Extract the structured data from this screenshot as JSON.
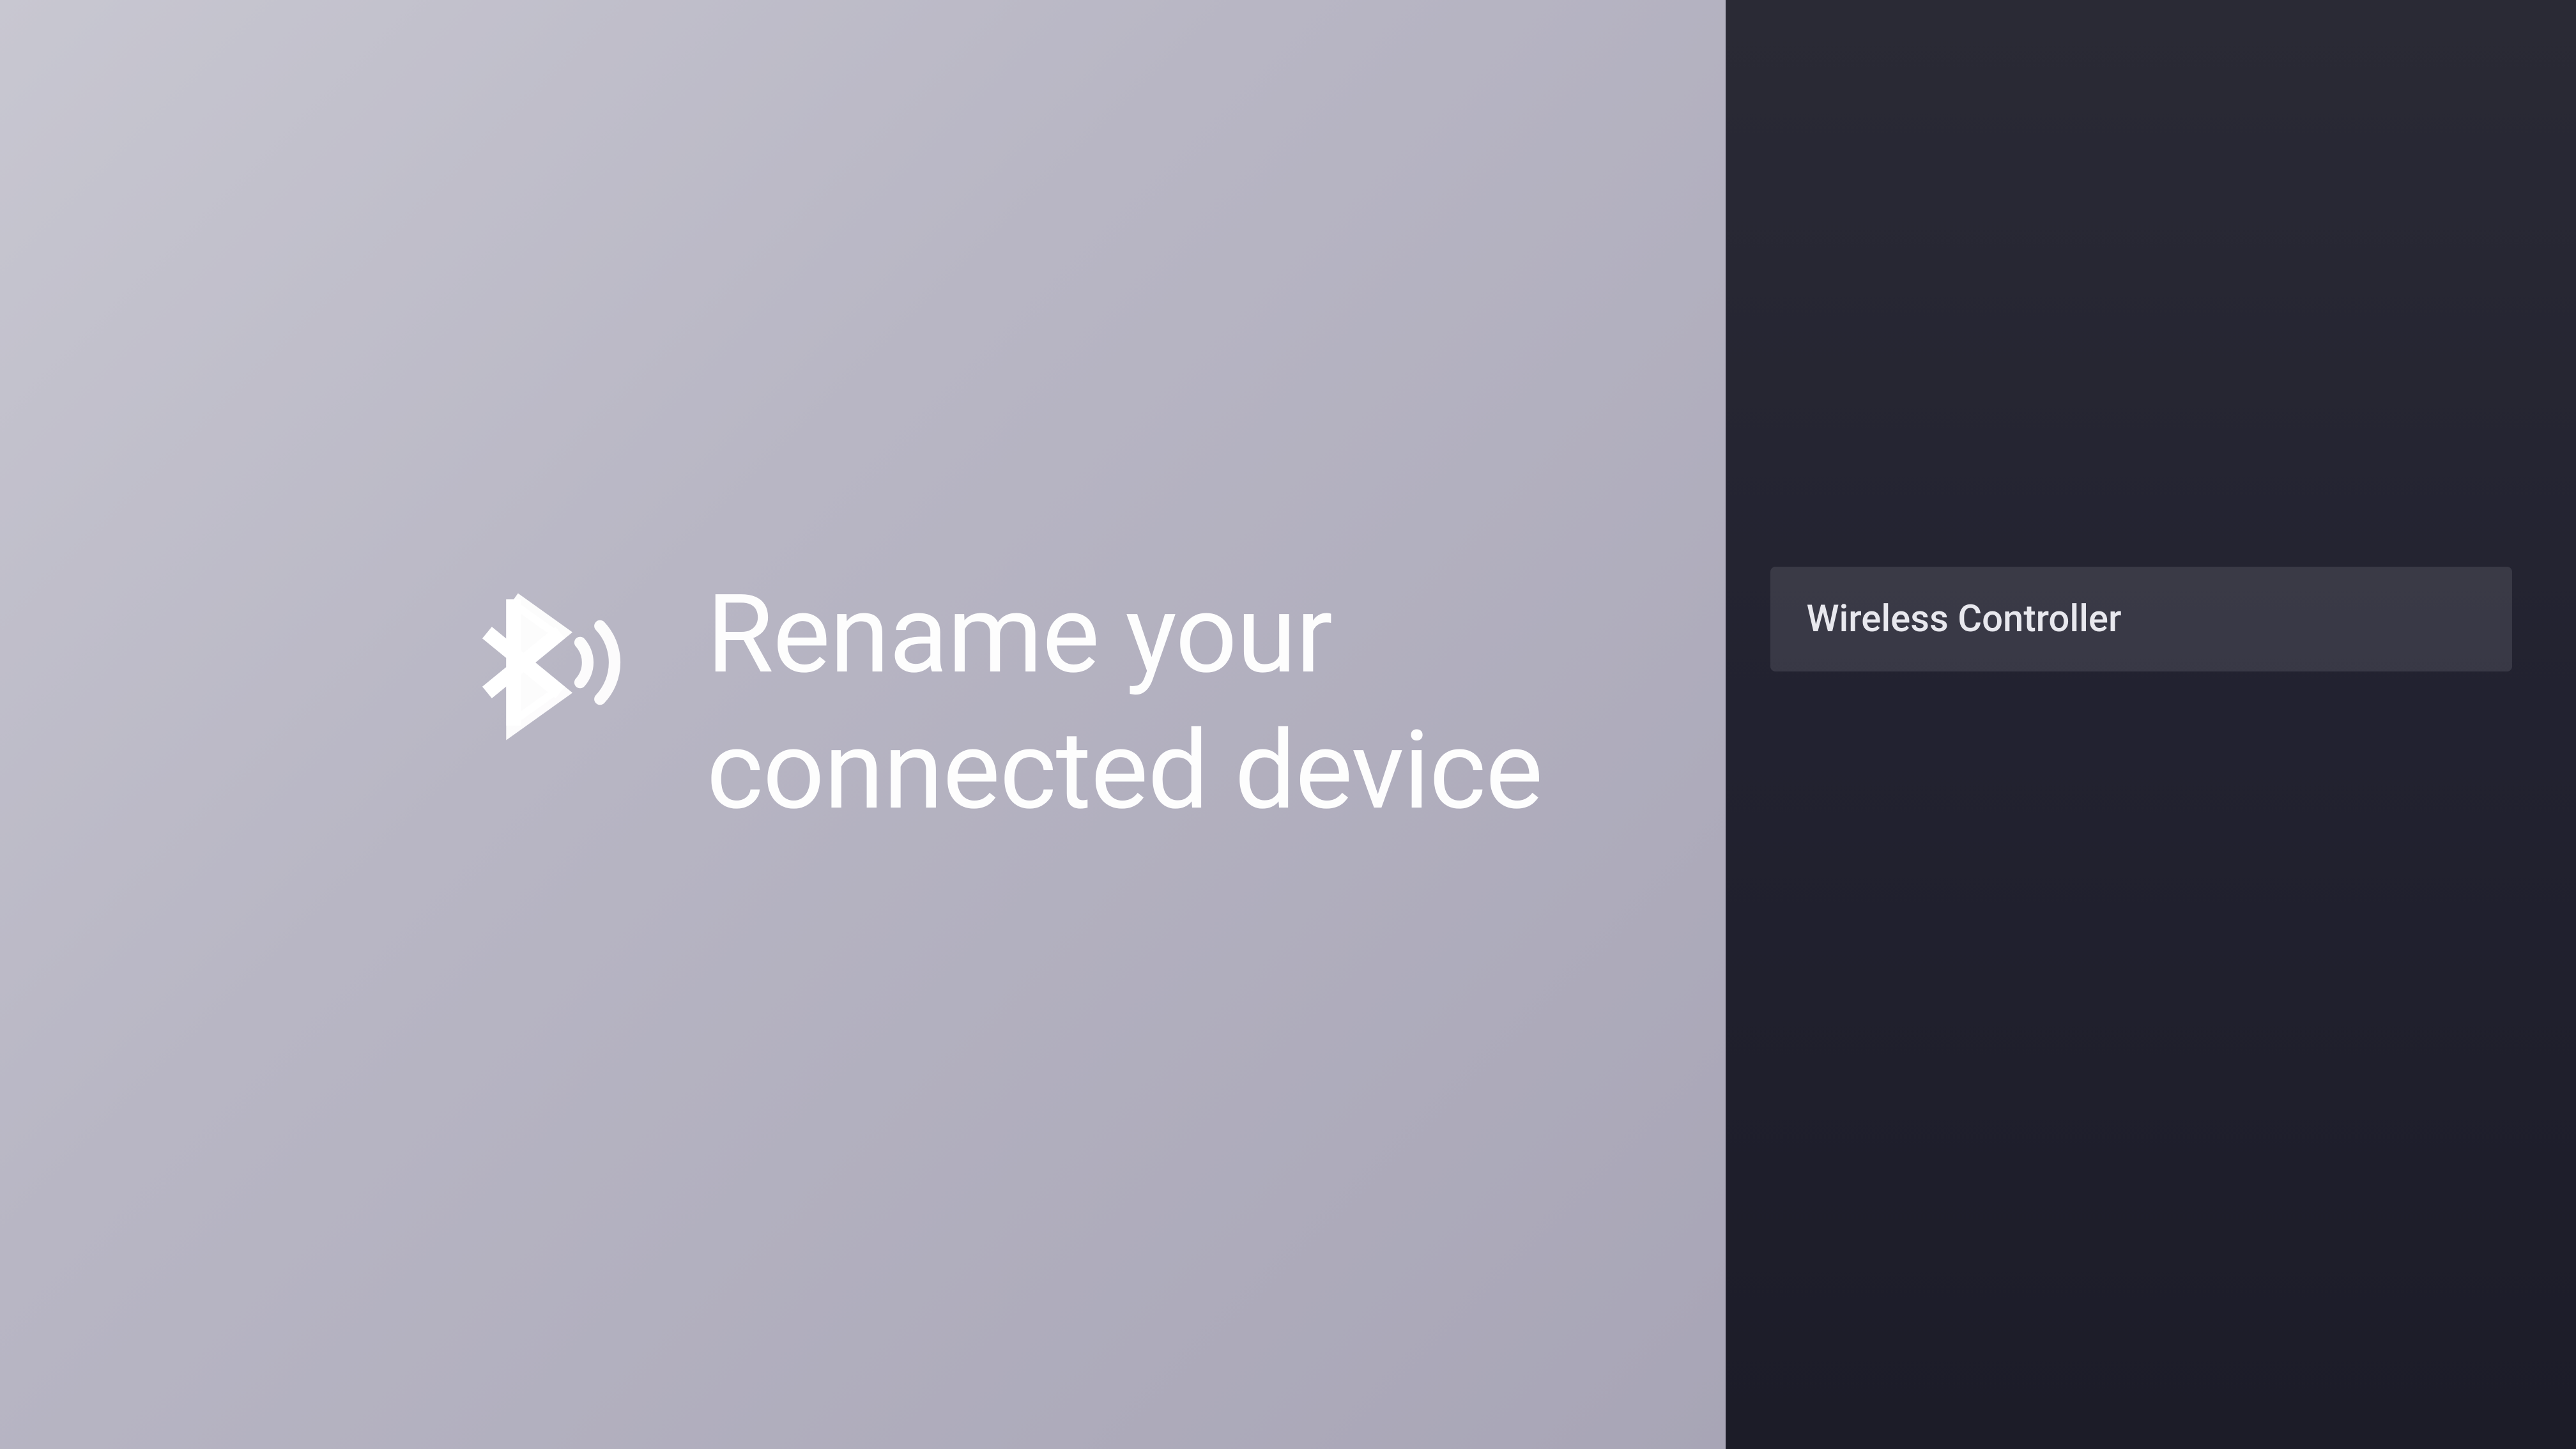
{
  "left": {
    "title": "Rename your connected device",
    "icon": "bluetooth-audio-icon"
  },
  "right": {
    "device_name": "Wireless Controller"
  }
}
